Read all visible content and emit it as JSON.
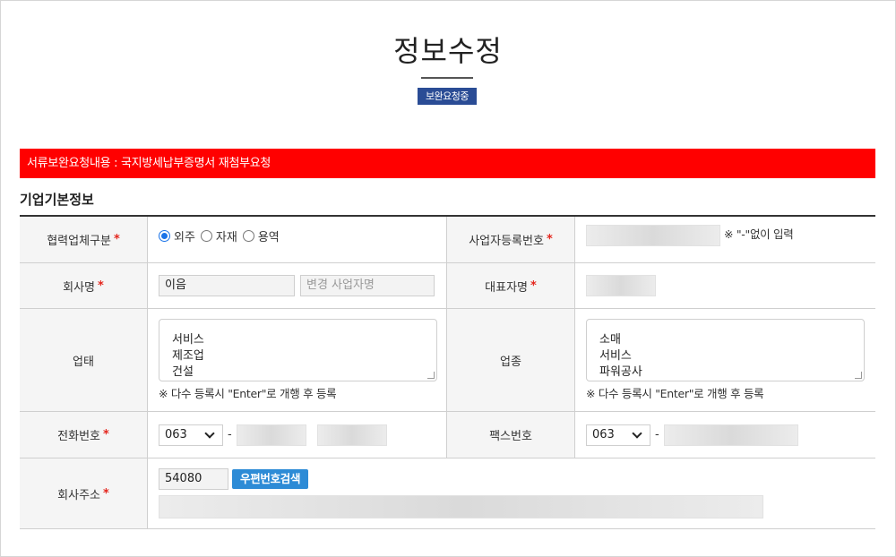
{
  "page": {
    "title": "정보수정",
    "status_badge": "보완요청중"
  },
  "alert": {
    "message": "서류보완요청내용 : 국지방세납부증명서 재첨부요청"
  },
  "section": {
    "title": "기업기본정보"
  },
  "form": {
    "partner_type": {
      "label": "협력업체구분",
      "required_mark": "*",
      "options": [
        {
          "label": "외주",
          "selected": true
        },
        {
          "label": "자재",
          "selected": false
        },
        {
          "label": "용역",
          "selected": false
        }
      ]
    },
    "business_reg_no": {
      "label": "사업자등록번호",
      "required_mark": "*",
      "value": "",
      "hint": "※ \"-\"없이 입력"
    },
    "company_name": {
      "label": "회사명",
      "required_mark": "*",
      "value": "이음",
      "change_placeholder": "변경 사업자명"
    },
    "ceo_name": {
      "label": "대표자명",
      "required_mark": "*",
      "value": ""
    },
    "business_type": {
      "label": "업태",
      "lines": [
        "서비스",
        "제조업",
        "건설"
      ],
      "note": "※ 다수 등록시 \"Enter\"로 개행 후 등록"
    },
    "business_item": {
      "label": "업종",
      "lines": [
        "소매",
        "서비스",
        "파워공사"
      ],
      "note": "※ 다수 등록시 \"Enter\"로 개행 후 등록"
    },
    "phone": {
      "label": "전화번호",
      "required_mark": "*",
      "area_code": "063",
      "dash": "-"
    },
    "fax": {
      "label": "팩스번호",
      "area_code": "063",
      "dash": "-"
    },
    "address": {
      "label": "회사주소",
      "required_mark": "*",
      "zip": "54080",
      "zip_search_button": "우편번호검색"
    }
  },
  "colors": {
    "alert": "#ff0000",
    "badge": "#2a4c95",
    "button": "#2d8bd6",
    "required": "#e4261d"
  }
}
